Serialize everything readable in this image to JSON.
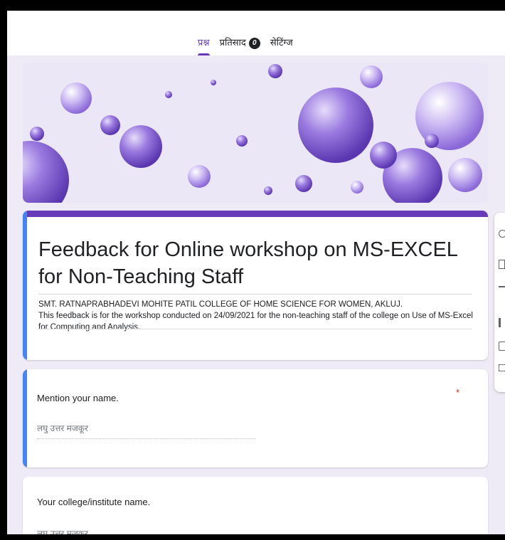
{
  "tabs": [
    {
      "label": "प्रश्न",
      "active": true
    },
    {
      "label": "प्रतिसाद",
      "badge": "0"
    },
    {
      "label": "सेटिंग्ज"
    }
  ],
  "form": {
    "title": "Feedback for Online workshop on MS-EXCEL for Non-Teaching Staff",
    "description_line1": "SMT. RATNAPRABHADEVI MOHITE PATIL COLLEGE OF HOME SCIENCE FOR WOMEN, AKLUJ.",
    "description_line2": "This feedback is for the workshop conducted on 24/09/2021 for the non-teaching staff of the college on Use of MS-Excel for Computing and Analysis."
  },
  "questions": [
    {
      "text": "Mention your name.",
      "required_mark": "*",
      "answer_placeholder": "लघु उत्तर मजकूर"
    },
    {
      "text": "Your college/institute name.",
      "answer_placeholder": "लघु उत्तर मजकूर"
    }
  ],
  "colors": {
    "theme": "#673ab7",
    "active_card": "#4285f4",
    "background": "#efebf6",
    "required": "#d93025"
  },
  "side_toolbar": {
    "icons": [
      "add-question-icon",
      "import-questions-icon",
      "add-title-icon",
      "add-image-icon",
      "add-video-icon",
      "add-section-icon"
    ]
  }
}
